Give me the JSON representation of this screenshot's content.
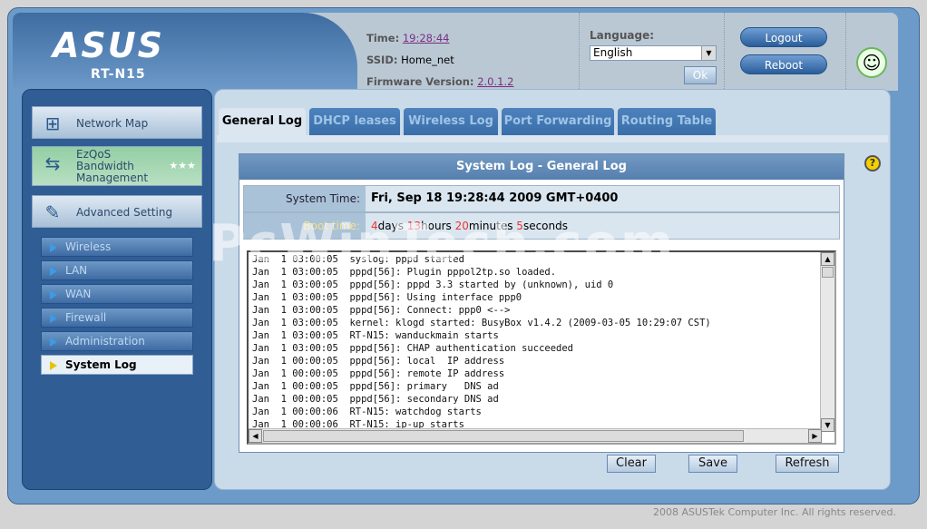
{
  "brand": {
    "logo": "ASUS",
    "model": "RT-N15"
  },
  "header": {
    "time_label": "Time:",
    "time_value": "19:28:44",
    "ssid_label": "SSID:",
    "ssid_value": "Home_net",
    "fw_label": "Firmware Version:",
    "fw_value": "2.0.1.2",
    "language_label": "Language:",
    "language_value": "English",
    "ok_label": "Ok",
    "logout_label": "Logout",
    "reboot_label": "Reboot"
  },
  "sidebar": {
    "network_map": "Network Map",
    "ezqos": "EzQoS Bandwidth Management",
    "advanced": "Advanced Setting",
    "items": [
      {
        "label": "Wireless"
      },
      {
        "label": "LAN"
      },
      {
        "label": "WAN"
      },
      {
        "label": "Firewall"
      },
      {
        "label": "Administration"
      },
      {
        "label": "System Log"
      }
    ]
  },
  "tabs": [
    {
      "label": "General Log"
    },
    {
      "label": "DHCP leases"
    },
    {
      "label": "Wireless Log"
    },
    {
      "label": "Port Forwarding"
    },
    {
      "label": "Routing Table"
    }
  ],
  "panel": {
    "title": "System Log - General Log",
    "system_time_label": "System Time:",
    "system_time_value": "Fri, Sep 18  19:28:44  2009 GMT+0400",
    "boot_time_label": "Boot time:",
    "boot_days": "4",
    "boot_days_unit": "days ",
    "boot_hours": "13",
    "boot_hours_unit": "hours ",
    "boot_minutes": "20",
    "boot_minutes_unit": "minutes ",
    "boot_seconds": "5",
    "boot_seconds_unit": "seconds",
    "log_text": "Jan  1 03:00:05  syslog: pppd started\nJan  1 03:00:05  pppd[56]: Plugin pppol2tp.so loaded.\nJan  1 03:00:05  pppd[56]: pppd 3.3 started by (unknown), uid 0\nJan  1 03:00:05  pppd[56]: Using interface ppp0\nJan  1 03:00:05  pppd[56]: Connect: ppp0 <-->\nJan  1 03:00:05  kernel: klogd started: BusyBox v1.4.2 (2009-03-05 10:29:07 CST)\nJan  1 03:00:05  RT-N15: wanduckmain starts\nJan  1 03:00:05  pppd[56]: CHAP authentication succeeded\nJan  1 00:00:05  pppd[56]: local  IP address\nJan  1 00:00:05  pppd[56]: remote IP address\nJan  1 00:00:05  pppd[56]: primary   DNS ad\nJan  1 00:00:05  pppd[56]: secondary DNS ad\nJan  1 00:00:06  RT-N15: watchdog starts\nJan  1 00:00:06  RT-N15: ip-up starts"
  },
  "buttons": {
    "clear": "Clear",
    "save": "Save",
    "refresh": "Refresh"
  },
  "footer": "2008 ASUSTek Computer Inc. All rights reserved.",
  "watermark": "PcWinTech.com"
}
